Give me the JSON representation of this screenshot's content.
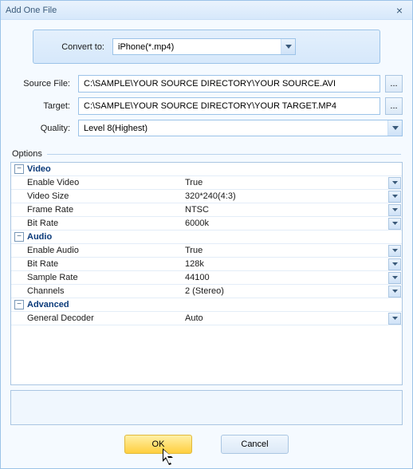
{
  "window": {
    "title": "Add One File"
  },
  "convert": {
    "label": "Convert to:",
    "value": "iPhone(*.mp4)"
  },
  "source": {
    "label": "Source File:",
    "value": "C:\\SAMPLE\\YOUR SOURCE DIRECTORY\\YOUR SOURCE.AVI"
  },
  "target": {
    "label": "Target:",
    "value": "C:\\SAMPLE\\YOUR SOURCE DIRECTORY\\YOUR TARGET.MP4"
  },
  "quality": {
    "label": "Quality:",
    "value": "Level 8(Highest)"
  },
  "options": {
    "label": "Options"
  },
  "grid": {
    "cats": [
      {
        "name": "Video",
        "props": [
          {
            "name": "Enable Video",
            "value": "True"
          },
          {
            "name": "Video Size",
            "value": "320*240(4:3)"
          },
          {
            "name": "Frame Rate",
            "value": "NTSC"
          },
          {
            "name": "Bit Rate",
            "value": "6000k"
          }
        ]
      },
      {
        "name": "Audio",
        "props": [
          {
            "name": "Enable Audio",
            "value": "True"
          },
          {
            "name": "Bit Rate",
            "value": "128k"
          },
          {
            "name": "Sample Rate",
            "value": "44100"
          },
          {
            "name": "Channels",
            "value": "2 (Stereo)"
          }
        ]
      },
      {
        "name": "Advanced",
        "props": [
          {
            "name": "General Decoder",
            "value": "Auto"
          }
        ]
      }
    ]
  },
  "buttons": {
    "ok": "OK",
    "cancel": "Cancel"
  }
}
